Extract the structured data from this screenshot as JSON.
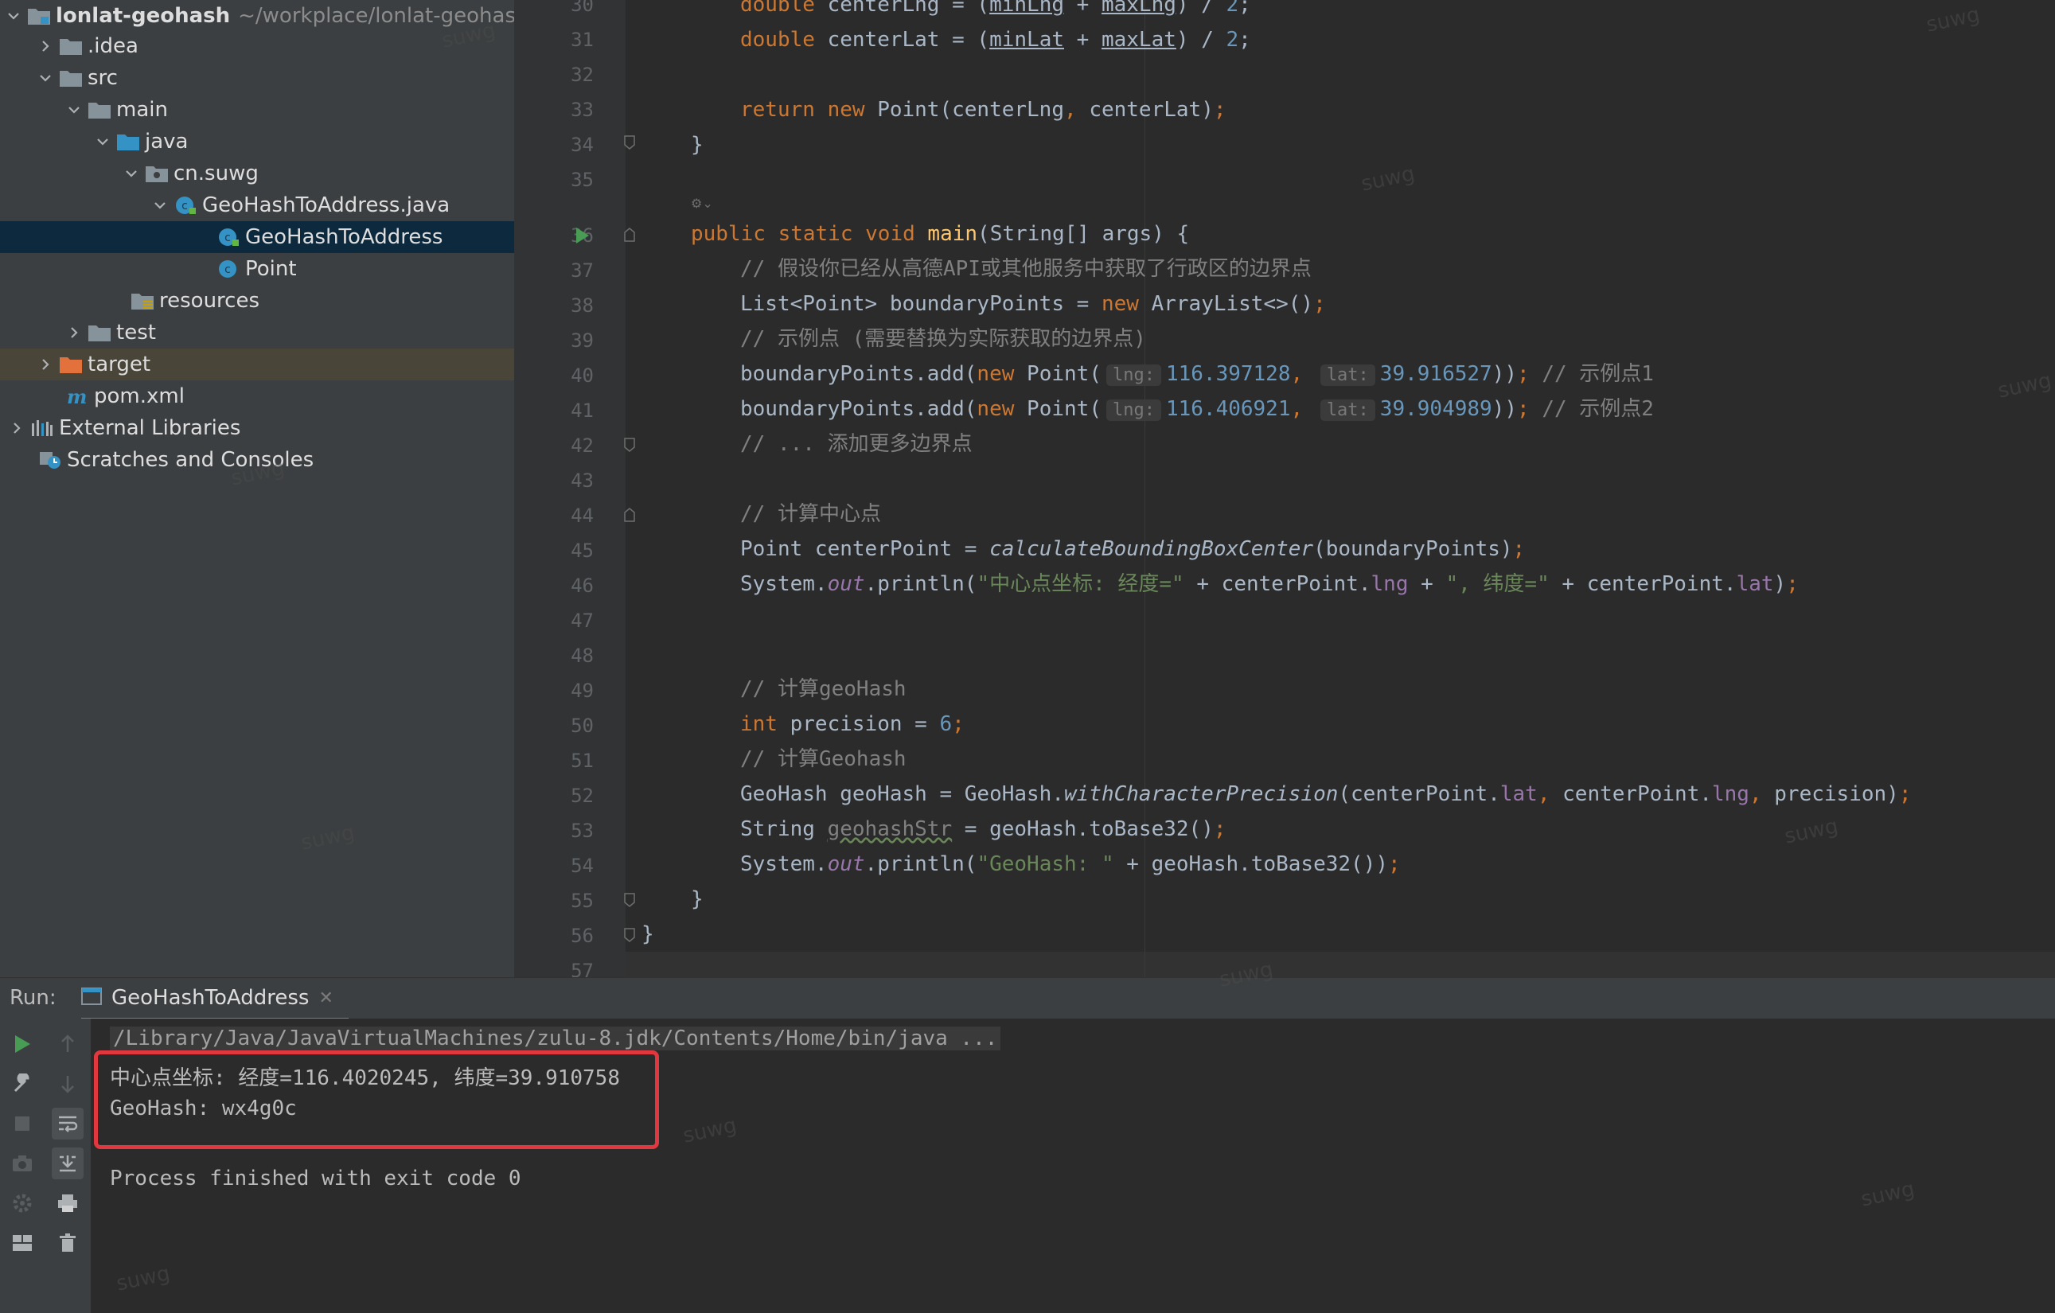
{
  "project_tree": {
    "root": {
      "name": "lonlat-geohash",
      "path": "~/workplace/lonlat-geohash"
    },
    "items": [
      {
        "label": ".idea",
        "icon": "folder-icon"
      },
      {
        "label": "src",
        "icon": "folder-icon"
      },
      {
        "label": "main",
        "icon": "folder-icon"
      },
      {
        "label": "java",
        "icon": "source-folder-icon"
      },
      {
        "label": "cn.suwg",
        "icon": "package-icon"
      },
      {
        "label": "GeoHashToAddress.java",
        "icon": "java-file-icon"
      },
      {
        "label": "GeoHashToAddress",
        "icon": "class-icon"
      },
      {
        "label": "Point",
        "icon": "class-icon"
      },
      {
        "label": "resources",
        "icon": "resources-folder-icon"
      },
      {
        "label": "test",
        "icon": "folder-icon"
      },
      {
        "label": "target",
        "icon": "excluded-folder-icon"
      },
      {
        "label": "pom.xml",
        "icon": "maven-icon"
      },
      {
        "label": "External Libraries",
        "icon": "libraries-icon"
      },
      {
        "label": "Scratches and Consoles",
        "icon": "scratches-icon"
      }
    ]
  },
  "editor": {
    "line_numbers": [
      "30",
      "31",
      "32",
      "33",
      "34",
      "35",
      "36",
      "37",
      "38",
      "39",
      "40",
      "41",
      "42",
      "43",
      "44",
      "45",
      "46",
      "47",
      "48",
      "49",
      "50",
      "51",
      "52",
      "53",
      "54",
      "55",
      "56",
      "57"
    ],
    "hints": {
      "lng": "lng:",
      "lat": "lat:"
    },
    "literals": {
      "two": "2",
      "p1_lng": "116.397128",
      "p1_lat": "39.916527",
      "p2_lng": "116.406921",
      "p2_lat": "39.904989",
      "six": "6",
      "str_center": "\"中心点坐标: 经度=\"",
      "str_lat": "\", 纬度=\"",
      "str_geohash": "\"GeoHash: \""
    },
    "comments": {
      "c37": "// 假设你已经从高德API或其他服务中获取了行政区的边界点",
      "c39": "// 示例点 (需要替换为实际获取的边界点)",
      "c40": "// 示例点1",
      "c41": "// 示例点2",
      "c42": "// ... 添加更多边界点",
      "c44": "// 计算中心点",
      "c49": "// 计算geoHash",
      "c51": "// 计算Geohash"
    }
  },
  "run": {
    "label": "Run:",
    "tab": "GeoHashToAddress",
    "console_lines": [
      "/Library/Java/JavaVirtualMachines/zulu-8.jdk/Contents/Home/bin/java ...",
      "中心点坐标: 经度=116.4020245, 纬度=39.910758",
      "GeoHash: wx4g0c",
      "",
      "Process finished with exit code 0"
    ]
  },
  "watermark": "suwg",
  "colors": {
    "keyword": "#cc7832",
    "number": "#6897bb",
    "string": "#6a8759",
    "comment": "#808080",
    "method": "#ffc66d",
    "field": "#9876aa",
    "highlight_box": "#e0383e",
    "selection": "#0d293e"
  }
}
